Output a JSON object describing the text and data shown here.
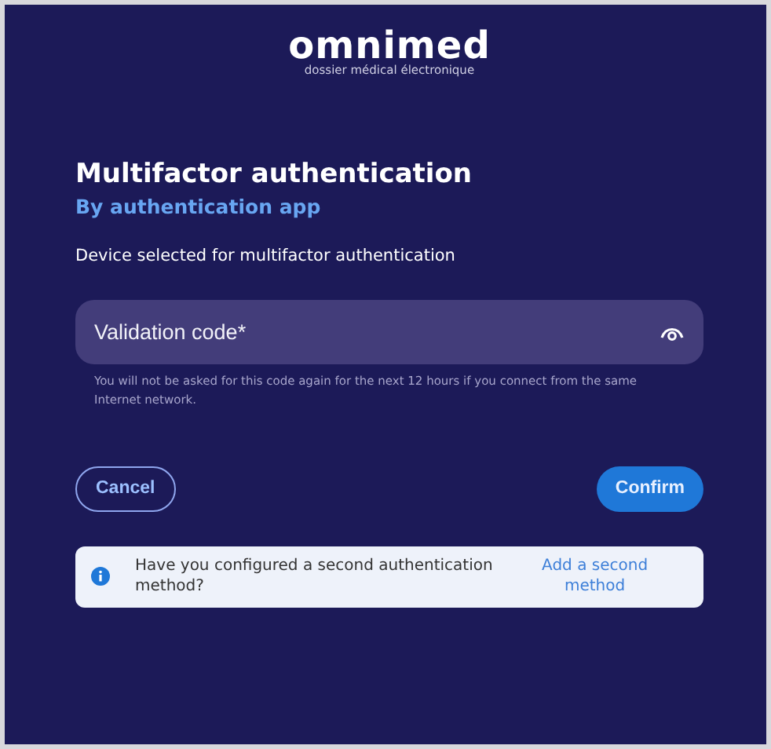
{
  "logo": {
    "name": "omnimed",
    "tagline": "dossier médical électronique"
  },
  "title": "Multifactor authentication",
  "subtitle": "By authentication app",
  "description": "Device selected for multifactor authentication",
  "code_field": {
    "placeholder": "Validation code*",
    "help": "You will not be asked for this code again for the next 12 hours if you connect from the same Internet network."
  },
  "buttons": [
    {
      "label": "Cancel",
      "kind": "outline"
    },
    {
      "label": "Confirm",
      "kind": "primary"
    }
  ],
  "notice": {
    "text": "Have you configured a second authentication method?",
    "link": "Add a second method"
  }
}
